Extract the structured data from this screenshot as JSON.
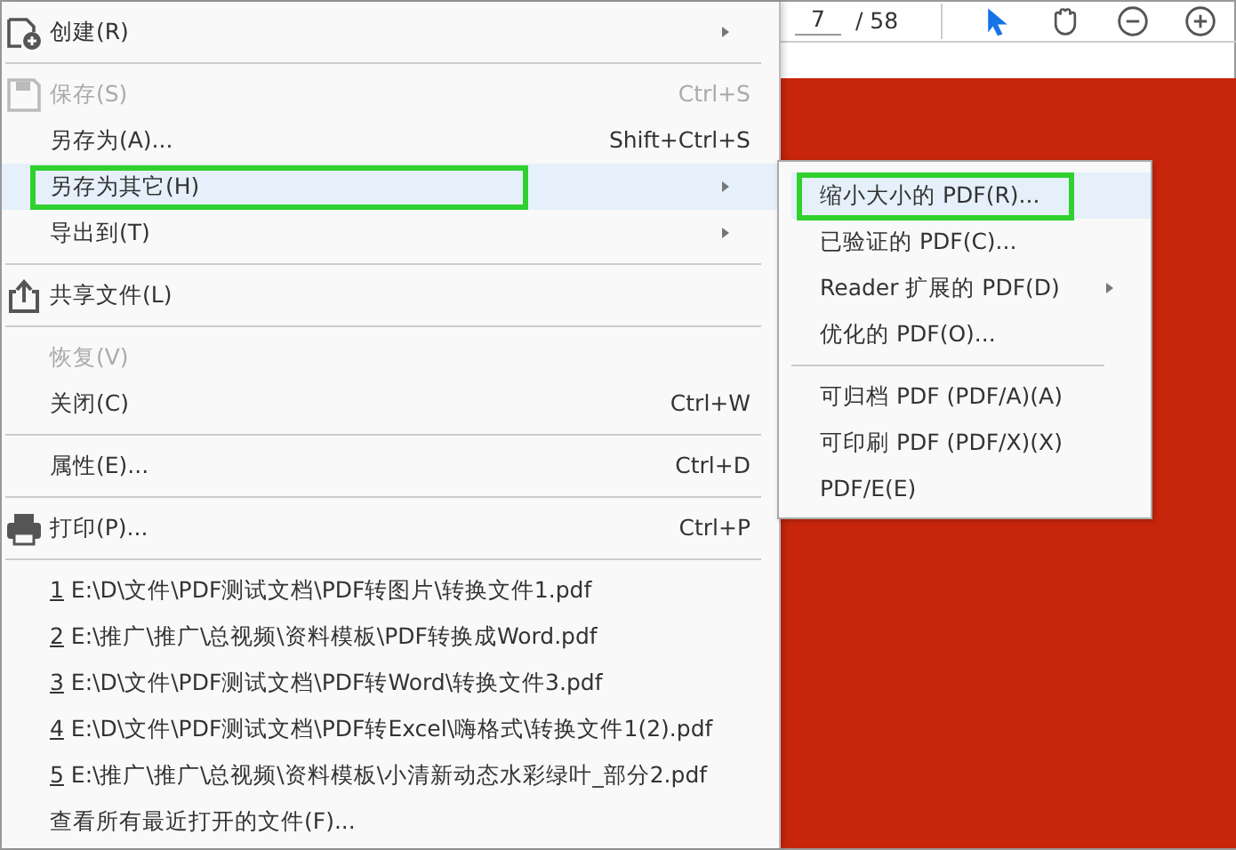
{
  "menu": [
    {
      "kind": "item",
      "label": "创建(R)",
      "submenu": true,
      "disabled": false,
      "selected": false,
      "outlined": false
    },
    {
      "kind": "separator"
    },
    {
      "kind": "item",
      "label": "保存(S)",
      "shortcut": "Ctrl+S",
      "submenu": false,
      "disabled": true,
      "selected": false,
      "outlined": false
    },
    {
      "kind": "item",
      "label": "另存为(A)...",
      "shortcut": "Shift+Ctrl+S",
      "submenu": false,
      "disabled": false,
      "selected": false,
      "outlined": false
    },
    {
      "kind": "item",
      "label": "另存为其它(H)",
      "submenu": true,
      "disabled": false,
      "selected": true,
      "outlined": true
    },
    {
      "kind": "item",
      "label": "导出到(T)",
      "submenu": true,
      "disabled": false,
      "selected": false,
      "outlined": false
    },
    {
      "kind": "separator"
    },
    {
      "kind": "item",
      "label": "共享文件(L)",
      "submenu": false,
      "disabled": false,
      "selected": false,
      "outlined": false
    },
    {
      "kind": "separator"
    },
    {
      "kind": "item",
      "label": "恢复(V)",
      "submenu": false,
      "disabled": true,
      "selected": false,
      "outlined": false
    },
    {
      "kind": "item",
      "label": "关闭(C)",
      "shortcut": "Ctrl+W",
      "submenu": false,
      "disabled": false,
      "selected": false,
      "outlined": false
    },
    {
      "kind": "separator"
    },
    {
      "kind": "item",
      "label": "属性(E)...",
      "shortcut": "Ctrl+D",
      "submenu": false,
      "disabled": false,
      "selected": false,
      "outlined": false
    },
    {
      "kind": "separator"
    },
    {
      "kind": "item",
      "label": "打印(P)...",
      "shortcut": "Ctrl+P",
      "submenu": false,
      "disabled": false,
      "selected": false,
      "outlined": false
    },
    {
      "kind": "separator"
    },
    {
      "kind": "recent",
      "number": "1",
      "label": "E:\\D\\文件\\PDF测试文档\\PDF转图片\\转换文件1.pdf"
    },
    {
      "kind": "recent",
      "number": "2",
      "label": "E:\\推广\\推广\\总视频\\资料模板\\PDF转换成Word.pdf"
    },
    {
      "kind": "recent",
      "number": "3",
      "label": "E:\\D\\文件\\PDF测试文档\\PDF转Word\\转换文件3.pdf"
    },
    {
      "kind": "recent",
      "number": "4",
      "label": "E:\\D\\文件\\PDF测试文档\\PDF转Excel\\嗨格式\\转换文件1(2).pdf"
    },
    {
      "kind": "recent",
      "number": "5",
      "label": "E:\\推广\\推广\\总视频\\资料模板\\小清新动态水彩绿叶_部分2.pdf"
    },
    {
      "kind": "item",
      "label": "查看所有最近打开的文件(F)...",
      "submenu": false,
      "disabled": false,
      "selected": false,
      "outlined": false
    }
  ],
  "toolbar": {
    "page_field": "7",
    "page_total": "/ 58"
  },
  "submenu": [
    {
      "kind": "item",
      "label": "缩小大小的 PDF(R)...",
      "submenu": false,
      "selected": true,
      "outlined": true
    },
    {
      "kind": "item",
      "label": "已验证的 PDF(C)...",
      "submenu": false,
      "selected": false,
      "outlined": false
    },
    {
      "kind": "item",
      "label": "Reader 扩展的 PDF(D)",
      "submenu": true,
      "selected": false,
      "outlined": false
    },
    {
      "kind": "item",
      "label": "优化的 PDF(O)...",
      "submenu": false,
      "selected": false,
      "outlined": false
    },
    {
      "kind": "separator"
    },
    {
      "kind": "item",
      "label": "可归档 PDF (PDF/A)(A)",
      "submenu": false,
      "selected": false,
      "outlined": false
    },
    {
      "kind": "item",
      "label": "可印刷 PDF (PDF/X)(X)",
      "submenu": false,
      "selected": false,
      "outlined": false
    },
    {
      "kind": "item",
      "label": "PDF/E(E)",
      "submenu": false,
      "selected": false,
      "outlined": false
    }
  ]
}
